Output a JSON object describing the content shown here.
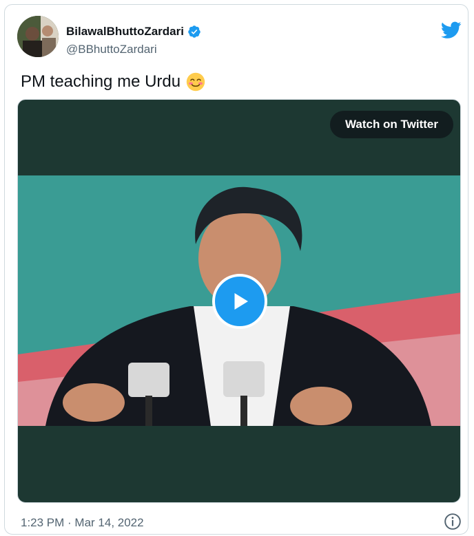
{
  "author": {
    "display_name": "BilawalBhuttoZardari",
    "handle": "@BBhuttoZardari",
    "verified": true
  },
  "tweet": {
    "text": "PM teaching me Urdu",
    "emoji": "smiling-face-icon"
  },
  "media": {
    "watch_label": "Watch on Twitter",
    "play_icon": "play-icon"
  },
  "footer": {
    "timestamp": "1:23 PM · Mar 14, 2022",
    "info_icon": "info-icon"
  },
  "colors": {
    "twitter_blue": "#1d9bf0",
    "video_bg": "#1d3832",
    "secondary_text": "#536471"
  }
}
